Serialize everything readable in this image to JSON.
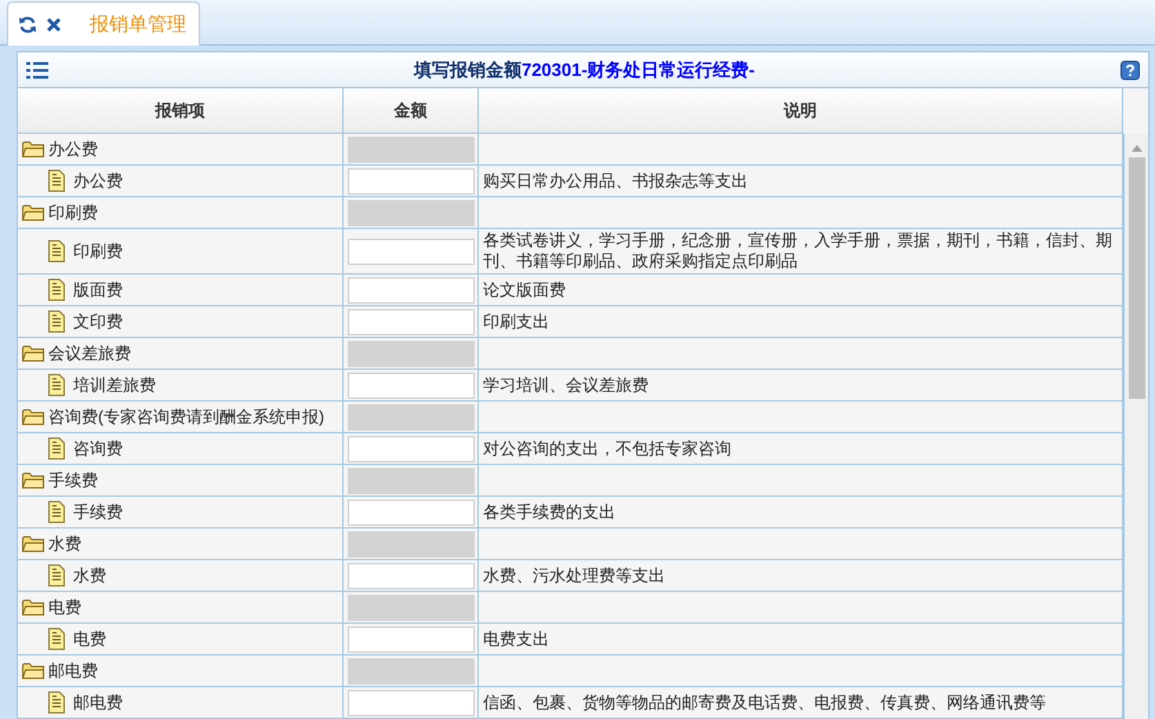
{
  "tabs": [
    {
      "label": "报销单管理",
      "selected": true
    }
  ],
  "panel": {
    "title": "填写报销金额",
    "title_code": "720301-财务处日常运行经费-"
  },
  "table": {
    "columns": [
      "报销项",
      "金额",
      "说明"
    ],
    "rows": [
      {
        "name": "办公费",
        "children": [
          {
            "name": "办公费",
            "description": "购买日常办公用品、书报杂志等支出"
          }
        ]
      },
      {
        "name": "印刷费",
        "children": [
          {
            "name": "印刷费",
            "description": "各类试卷讲义，学习手册，纪念册，宣传册，入学手册，票据，期刊，书籍，信封、期刊、书籍等印刷品、政府采购指定点印刷品"
          },
          {
            "name": "版面费",
            "description": "论文版面费"
          },
          {
            "name": "文印费",
            "description": "印刷支出"
          }
        ]
      },
      {
        "name": "会议差旅费",
        "children": [
          {
            "name": "培训差旅费",
            "description": "学习培训、会议差旅费"
          }
        ]
      },
      {
        "name": "咨询费(专家咨询费请到酬金系统申报)",
        "children": [
          {
            "name": "咨询费",
            "description": "对公咨询的支出，不包括专家咨询"
          }
        ]
      },
      {
        "name": "手续费",
        "children": [
          {
            "name": "手续费",
            "description": "各类手续费的支出"
          }
        ]
      },
      {
        "name": "水费",
        "children": [
          {
            "name": "水费",
            "description": "水费、污水处理费等支出"
          }
        ]
      },
      {
        "name": "电费",
        "children": [
          {
            "name": "电费",
            "description": "电费支出"
          }
        ]
      },
      {
        "name": "邮电费",
        "children": [
          {
            "name": "邮电费",
            "description": "信函、包裹、货物等物品的邮寄费及电话费、电报费、传真费、网络通讯费等"
          }
        ]
      }
    ]
  }
}
